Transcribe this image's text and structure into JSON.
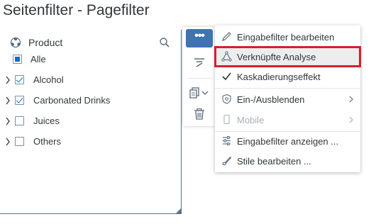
{
  "page_title": "Seitenfilter - Pagefilter",
  "filter": {
    "dimension": "Product",
    "items": [
      {
        "label": "Alle",
        "state": "partial"
      },
      {
        "label": "Alcohol",
        "state": "checked"
      },
      {
        "label": "Carbonated Drinks",
        "state": "checked"
      },
      {
        "label": "Juices",
        "state": "unchecked"
      },
      {
        "label": "Others",
        "state": "unchecked"
      }
    ]
  },
  "toolbar": {
    "more_label": "•••"
  },
  "menu": {
    "items": [
      {
        "label": "Eingabefilter bearbeiten",
        "icon": "pencil-icon"
      },
      {
        "label": "Verknüpfte Analyse",
        "icon": "linked-analysis-icon"
      },
      {
        "label": "Kaskadierungseffekt",
        "icon": "checkmark-icon"
      },
      {
        "label": "Ein-/Ausblenden",
        "icon": "show-hide-icon"
      },
      {
        "label": "Mobile",
        "icon": "mobile-icon"
      },
      {
        "label": "Eingabefilter anzeigen ...",
        "icon": "filter-settings-icon"
      },
      {
        "label": "Stile bearbeiten ...",
        "icon": "paint-brush-icon"
      }
    ]
  },
  "colors": {
    "accent": "#3f73b3",
    "checkbox": "#0a6ed1",
    "highlight_border": "#d6202a"
  }
}
